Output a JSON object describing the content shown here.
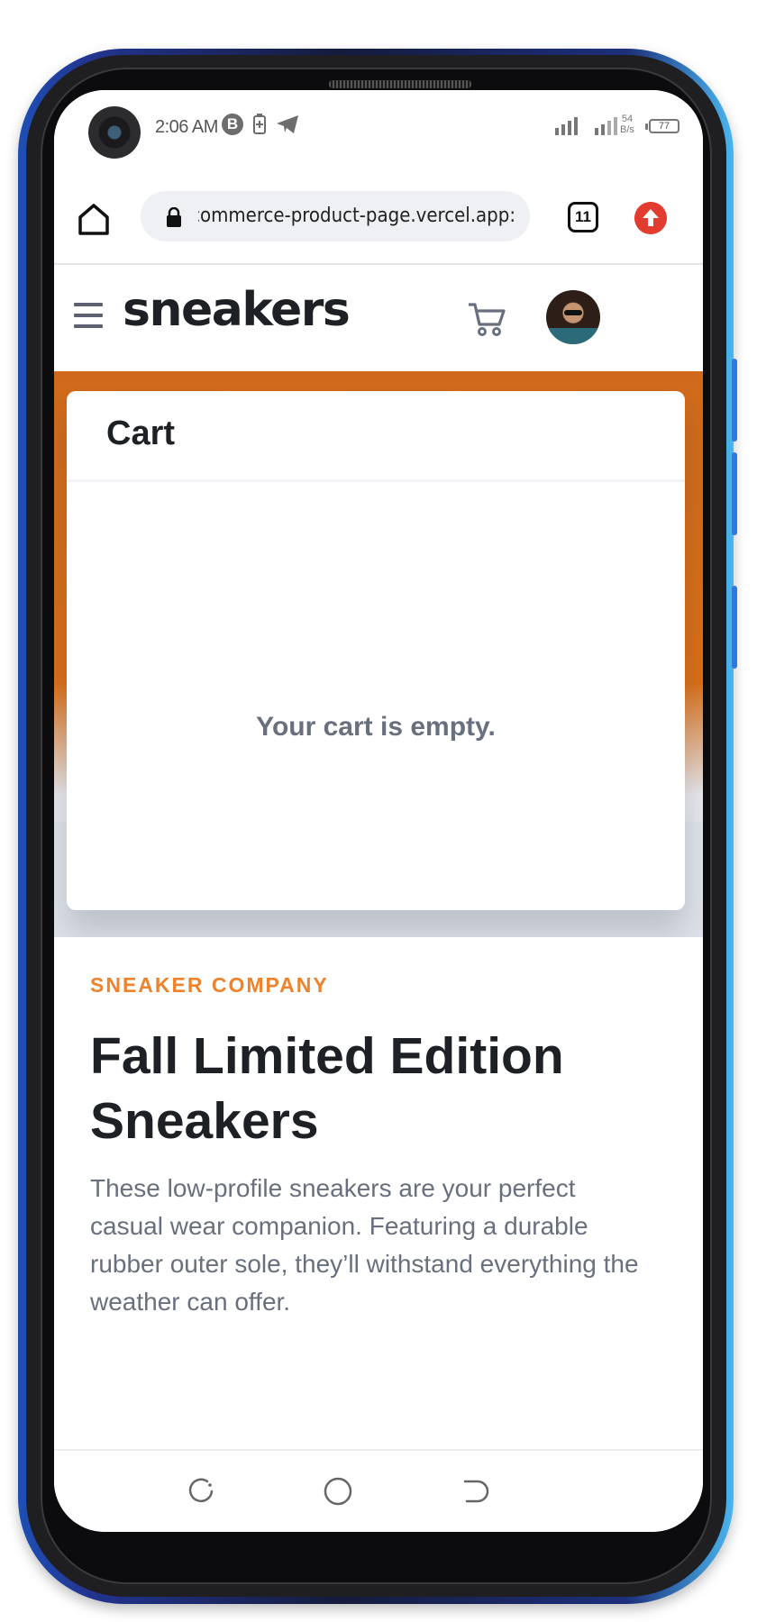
{
  "status_bar": {
    "time": "2:06 AM",
    "b_badge": "B",
    "net_speed_value": "54",
    "net_speed_unit": "B/s",
    "battery_level": "77"
  },
  "browser": {
    "url": ":commerce-product-page.vercel.app",
    "tab_count": "11"
  },
  "site": {
    "logo": "sneakers"
  },
  "cart": {
    "title": "Cart",
    "empty_message": "Your cart is empty."
  },
  "product": {
    "company": "SNEAKER COMPANY",
    "title": "Fall Limited Edition Sneakers",
    "description": "These low-profile sneakers are your perfect casual wear companion. Featuring a durable rubber outer sole, they’ll withstand everything the weather can offer."
  },
  "colors": {
    "accent_orange": "#f0822c",
    "heading_dark": "#1d2025",
    "text_gray": "#69707d",
    "update_red": "#e23b2f"
  },
  "icons": [
    "home-icon",
    "lock-icon",
    "tabs-icon",
    "update-arrow-icon",
    "menu-icon",
    "cart-icon",
    "recent-apps-icon",
    "home-nav-icon",
    "back-icon"
  ]
}
